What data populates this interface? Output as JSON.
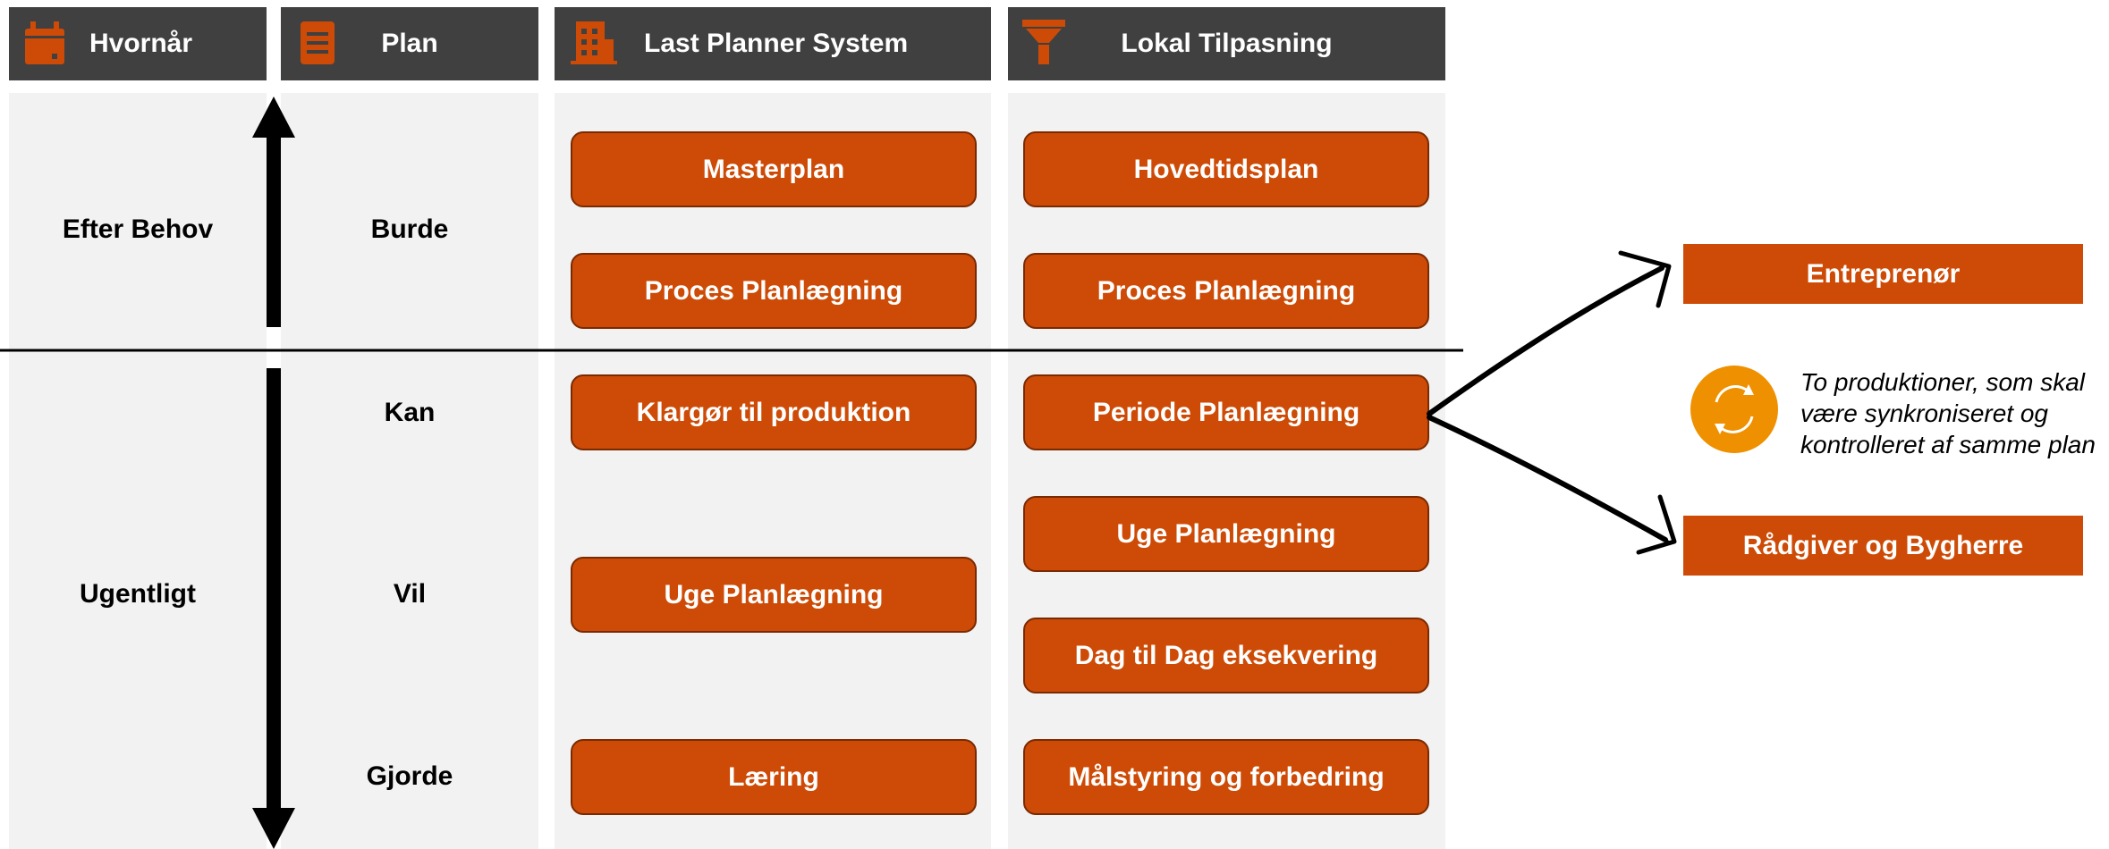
{
  "headers": {
    "hvornaar": "Hvornår",
    "plan": "Plan",
    "lps": "Last Planner System",
    "lokal": "Lokal Tilpasning"
  },
  "icons": {
    "hvornaar": "calendar-icon",
    "plan": "document-icon",
    "lps": "building-icon",
    "lokal": "funnel-icon",
    "sync": "sync-cycle-icon"
  },
  "colors": {
    "header_bg": "#404040",
    "accent": "#cd4b06",
    "sync_circle": "#ef9000",
    "column_bg": "#f2f2f2"
  },
  "frequency": {
    "top": "Efter Behov",
    "bottom": "Ugentligt"
  },
  "plan_levels": [
    "Burde",
    "Kan",
    "Vil",
    "Gjorde"
  ],
  "last_planner": [
    "Masterplan",
    "Proces Planlægning",
    "Klargør til produktion",
    "Uge Planlægning",
    "Læring"
  ],
  "lokal_tilpasning": [
    "Hovedtidsplan",
    "Proces Planlægning",
    "Periode Planlægning",
    "Uge Planlægning",
    "Dag til Dag eksekvering",
    "Målstyring og forbedring"
  ],
  "targets": {
    "top": "Entreprenør",
    "bottom": "Rådgiver og Bygherre"
  },
  "note": [
    "To produktioner, som skal",
    "være synkroniseret og",
    "kontrolleret af samme plan"
  ]
}
